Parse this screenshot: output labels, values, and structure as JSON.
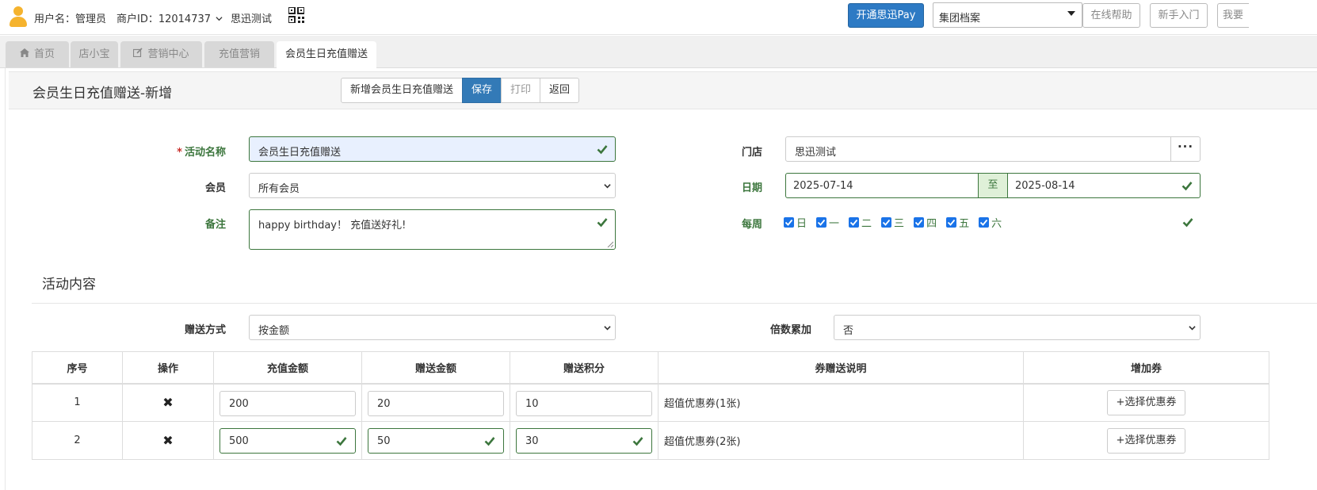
{
  "topbar": {
    "username": "用户名：管理员",
    "merchant_id": "商户ID：12014737",
    "store": "思迅测试",
    "pay_button": "开通思迅Pay",
    "archive_select": "集团档案",
    "help_button": "在线帮助",
    "newbie_button": "新手入门",
    "partial_button": "我要"
  },
  "tabs": [
    {
      "label": "首页",
      "icon": "home-icon"
    },
    {
      "label": "店小宝"
    },
    {
      "label": "营销中心",
      "icon": "edit-icon"
    },
    {
      "label": "充值营销"
    },
    {
      "label": "会员生日充值赠送",
      "active": true
    }
  ],
  "page": {
    "title": "会员生日充值赠送-新增",
    "buttons": {
      "new": "新增会员生日充值赠送",
      "save": "保存",
      "print": "打印",
      "back": "返回"
    }
  },
  "form": {
    "activity_name": {
      "label": "活动名称",
      "value": "会员生日充值赠送"
    },
    "member": {
      "label": "会员",
      "value": "所有会员"
    },
    "remark": {
      "label": "备注",
      "value": "happy birthday！ 充值送好礼!"
    },
    "store": {
      "label": "门店",
      "value": "思迅测试"
    },
    "date": {
      "label": "日期",
      "start": "2025-07-14",
      "to": "至",
      "end": "2025-08-14"
    },
    "weekly": {
      "label": "每周",
      "days": [
        "日",
        "一",
        "二",
        "三",
        "四",
        "五",
        "六"
      ]
    }
  },
  "content": {
    "title": "活动内容",
    "gift_mode": {
      "label": "赠送方式",
      "value": "按金额"
    },
    "multiple": {
      "label": "倍数累加",
      "value": "否"
    }
  },
  "table": {
    "headers": [
      "序号",
      "操作",
      "充值金额",
      "赠送金额",
      "赠送积分",
      "券赠送说明",
      "增加券"
    ],
    "rows": [
      {
        "no": "1",
        "recharge": "200",
        "gift_amount": "20",
        "points": "10",
        "coupon_desc": "超值优惠券(1张)",
        "button": "+选择优惠券"
      },
      {
        "no": "2",
        "recharge": "500",
        "gift_amount": "50",
        "points": "30",
        "coupon_desc": "超值优惠券(2张)",
        "button": "+选择优惠券"
      }
    ]
  },
  "colors": {
    "accent": "#337ab7",
    "success": "#3c763d",
    "required": "#c9302c"
  }
}
